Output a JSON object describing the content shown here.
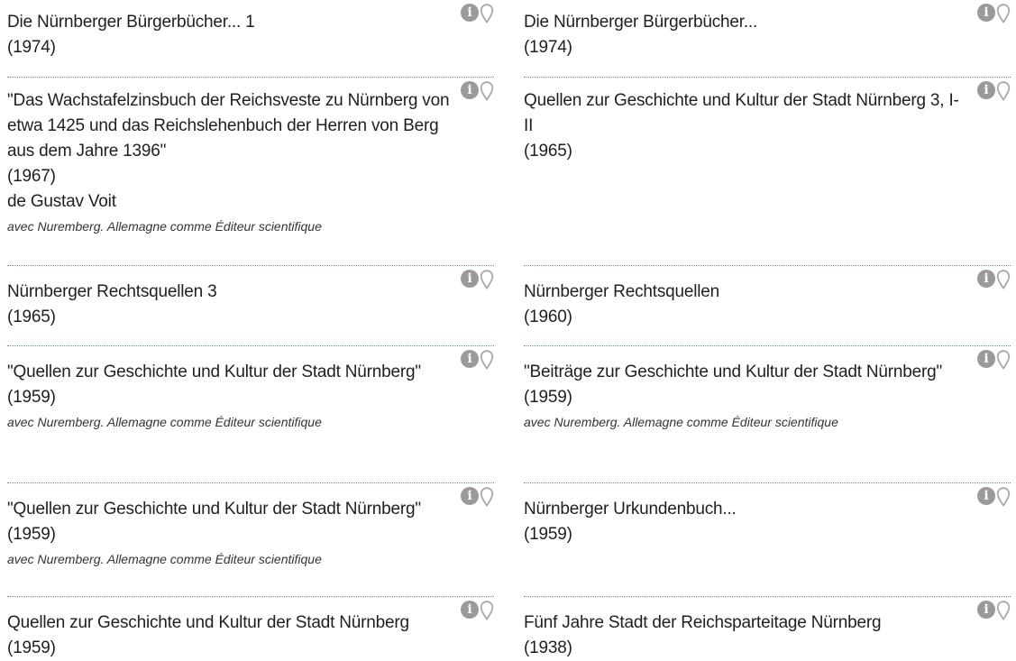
{
  "left_column": [
    {
      "title": "Die Nürnberger Bürgerbücher... 1",
      "year": "(1974)"
    },
    {
      "title": "\"Das Wachstafelzinsbuch der Reichsveste zu Nürnberg von etwa 1425 und das Reichslehenbuch der Herren von Berg aus dem Jahre 1396\"",
      "year": "(1967)",
      "author": "de Gustav Voit",
      "note": "avec Nuremberg. Allemagne comme Éditeur scientifique"
    },
    {
      "title": "Nürnberger Rechtsquellen 3",
      "year": "(1965)"
    },
    {
      "title": "\"Quellen zur Geschichte und Kultur der Stadt Nürnberg\"",
      "year": "(1959)",
      "note": "avec Nuremberg. Allemagne comme Éditeur scientifique"
    },
    {
      "title": "\"Quellen zur Geschichte und Kultur der Stadt Nürnberg\"",
      "year": "(1959)",
      "note": "avec Nuremberg. Allemagne comme Éditeur scientifique"
    },
    {
      "title": "Quellen zur Geschichte und Kultur der Stadt Nürnberg",
      "year": "(1959)"
    }
  ],
  "right_column": [
    {
      "title": "Die Nürnberger Bürgerbücher...",
      "year": "(1974)"
    },
    {
      "title": "Quellen zur Geschichte und Kultur der Stadt Nürnberg 3, I-II",
      "year": "(1965)"
    },
    {
      "title": "Nürnberger Rechtsquellen",
      "year": "(1960)"
    },
    {
      "title": "\"Beiträge zur Geschichte und Kultur der Stadt Nürnberg\"",
      "year": "(1959)",
      "note": "avec Nuremberg. Allemagne comme Éditeur scientifique"
    },
    {
      "title": "Nürnberger Urkundenbuch...",
      "year": "(1959)"
    },
    {
      "title": "Fünf Jahre Stadt der Reichsparteitage Nürnberg",
      "year": "(1938)"
    }
  ],
  "icons": {
    "info": "info-circle-icon",
    "location": "map-pin-icon",
    "color": "#9a9a9a"
  }
}
